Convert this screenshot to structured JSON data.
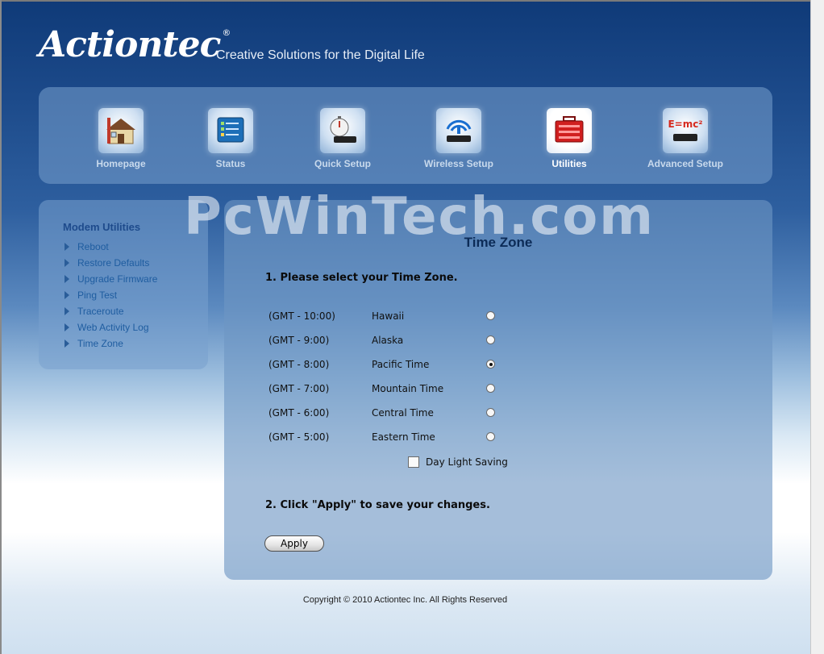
{
  "brand": {
    "logo_text": "Actiontec",
    "tagline": "Creative Solutions for the Digital Life"
  },
  "nav": {
    "items": [
      {
        "label": "Homepage",
        "icon": "house-icon"
      },
      {
        "label": "Status",
        "icon": "status-screen-icon"
      },
      {
        "label": "Quick Setup",
        "icon": "stopwatch-router-icon"
      },
      {
        "label": "Wireless Setup",
        "icon": "wireless-router-icon"
      },
      {
        "label": "Utilities",
        "icon": "toolbox-icon",
        "active": true
      },
      {
        "label": "Advanced Setup",
        "icon": "emc2-router-icon",
        "icon_text": "E=mc²"
      }
    ]
  },
  "watermark": "PcWinTech.com",
  "sidebar": {
    "title": "Modem Utilities",
    "items": [
      {
        "label": "Reboot"
      },
      {
        "label": "Restore Defaults"
      },
      {
        "label": "Upgrade Firmware"
      },
      {
        "label": "Ping Test"
      },
      {
        "label": "Traceroute"
      },
      {
        "label": "Web Activity Log"
      },
      {
        "label": "Time Zone"
      }
    ]
  },
  "main": {
    "title": "Time Zone",
    "step1": "1. Please select your Time Zone.",
    "timezones": [
      {
        "offset": "(GMT - 10:00)",
        "name": "Hawaii",
        "selected": false
      },
      {
        "offset": "(GMT - 9:00)",
        "name": "Alaska",
        "selected": false
      },
      {
        "offset": "(GMT - 8:00)",
        "name": "Pacific Time",
        "selected": true
      },
      {
        "offset": "(GMT - 7:00)",
        "name": "Mountain Time",
        "selected": false
      },
      {
        "offset": "(GMT - 6:00)",
        "name": "Central Time",
        "selected": false
      },
      {
        "offset": "(GMT - 5:00)",
        "name": "Eastern Time",
        "selected": false
      }
    ],
    "daylight_saving": {
      "label": "Day Light Saving",
      "checked": false
    },
    "step2": "2. Click \"Apply\" to save your changes.",
    "apply_label": "Apply"
  },
  "footer": {
    "copyright": "Copyright © 2010 Actiontec Inc. All Rights Reserved"
  }
}
